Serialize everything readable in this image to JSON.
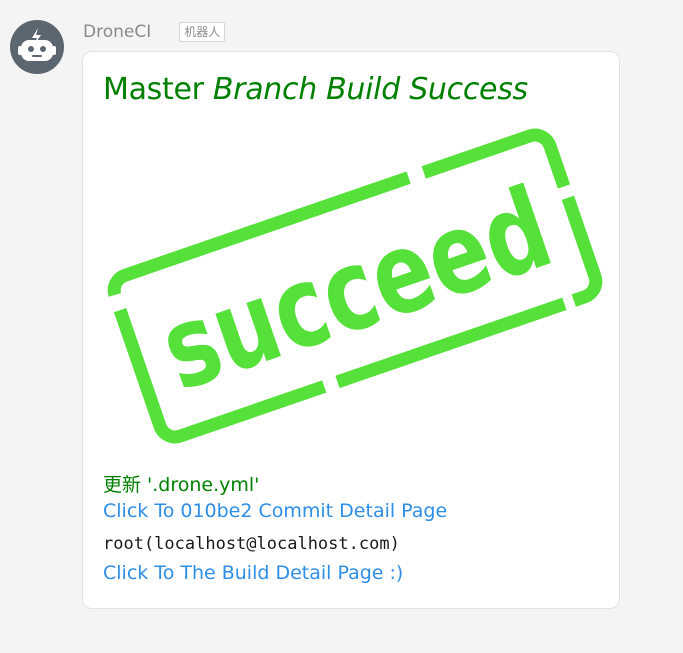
{
  "sender": {
    "name": "DroneCI",
    "badge": "机器人",
    "avatar_icon": "robot-icon",
    "avatar_color": "#5b6670"
  },
  "message": {
    "title_plain": "Master ",
    "title_italic": "Branch Build Success",
    "title_color": "#008000",
    "stamp_text": "succeed",
    "stamp_color": "#55e03a",
    "commit_message": "更新 '.drone.yml'",
    "commit_link": "Click To 010be2 Commit Detail Page",
    "author": "root(localhost@localhost.com)",
    "build_link": "Click To The Build Detail Page :)",
    "link_color": "#2f8ee6"
  }
}
